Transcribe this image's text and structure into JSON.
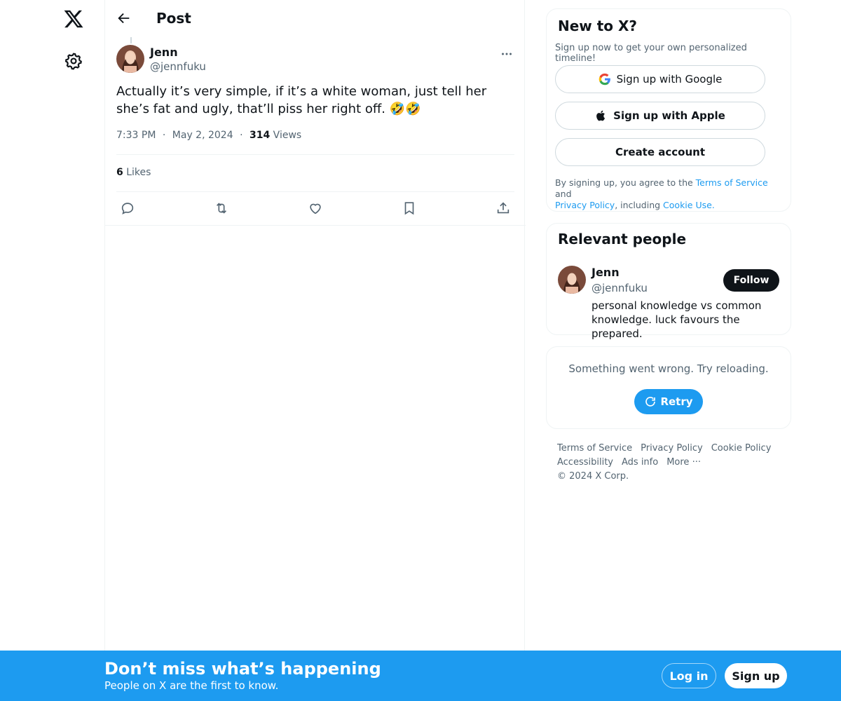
{
  "header": {
    "title": "Post"
  },
  "post": {
    "author_name": "Jenn",
    "author_handle": "@jennfuku",
    "text": "Actually it’s very simple, if it’s a white woman, just tell her she’s fat and ugly, that’ll piss her right off. 🤣🤣",
    "time": "7:33 PM",
    "sep1": "·",
    "date": "May 2, 2024",
    "sep2": "·",
    "views_count": "314",
    "views_label": "Views",
    "likes_count": "6",
    "likes_label": "Likes"
  },
  "signup_card": {
    "title": "New to X?",
    "subtitle": "Sign up now to get your own personalized timeline!",
    "google_label": "Sign up with Google",
    "apple_label": "Sign up with Apple",
    "create_label": "Create account",
    "legal_prefix": "By signing up, you agree to the ",
    "terms_link": "Terms of Service",
    "legal_and": " and",
    "privacy_link": "Privacy Policy",
    "legal_including": ", including ",
    "cookie_link": "Cookie Use."
  },
  "relevant_people": {
    "title": "Relevant people",
    "name": "Jenn",
    "handle": "@jennfuku",
    "bio": "personal knowledge vs common knowledge. luck favours the prepared.",
    "follow_label": "Follow"
  },
  "error_card": {
    "message": "Something went wrong. Try reloading.",
    "retry_label": "Retry"
  },
  "footer": {
    "terms": "Terms of Service",
    "privacy": "Privacy Policy",
    "cookie": "Cookie Policy",
    "accessibility": "Accessibility",
    "ads": "Ads info",
    "more": "More ···",
    "copyright": "© 2024 X Corp."
  },
  "banner": {
    "title": "Don’t miss what’s happening",
    "subtitle": "People on X are the first to know.",
    "login_label": "Log in",
    "signup_label": "Sign up"
  },
  "colors": {
    "accent": "#1d9bf0",
    "text": "#0f1419",
    "secondary": "#536471"
  }
}
